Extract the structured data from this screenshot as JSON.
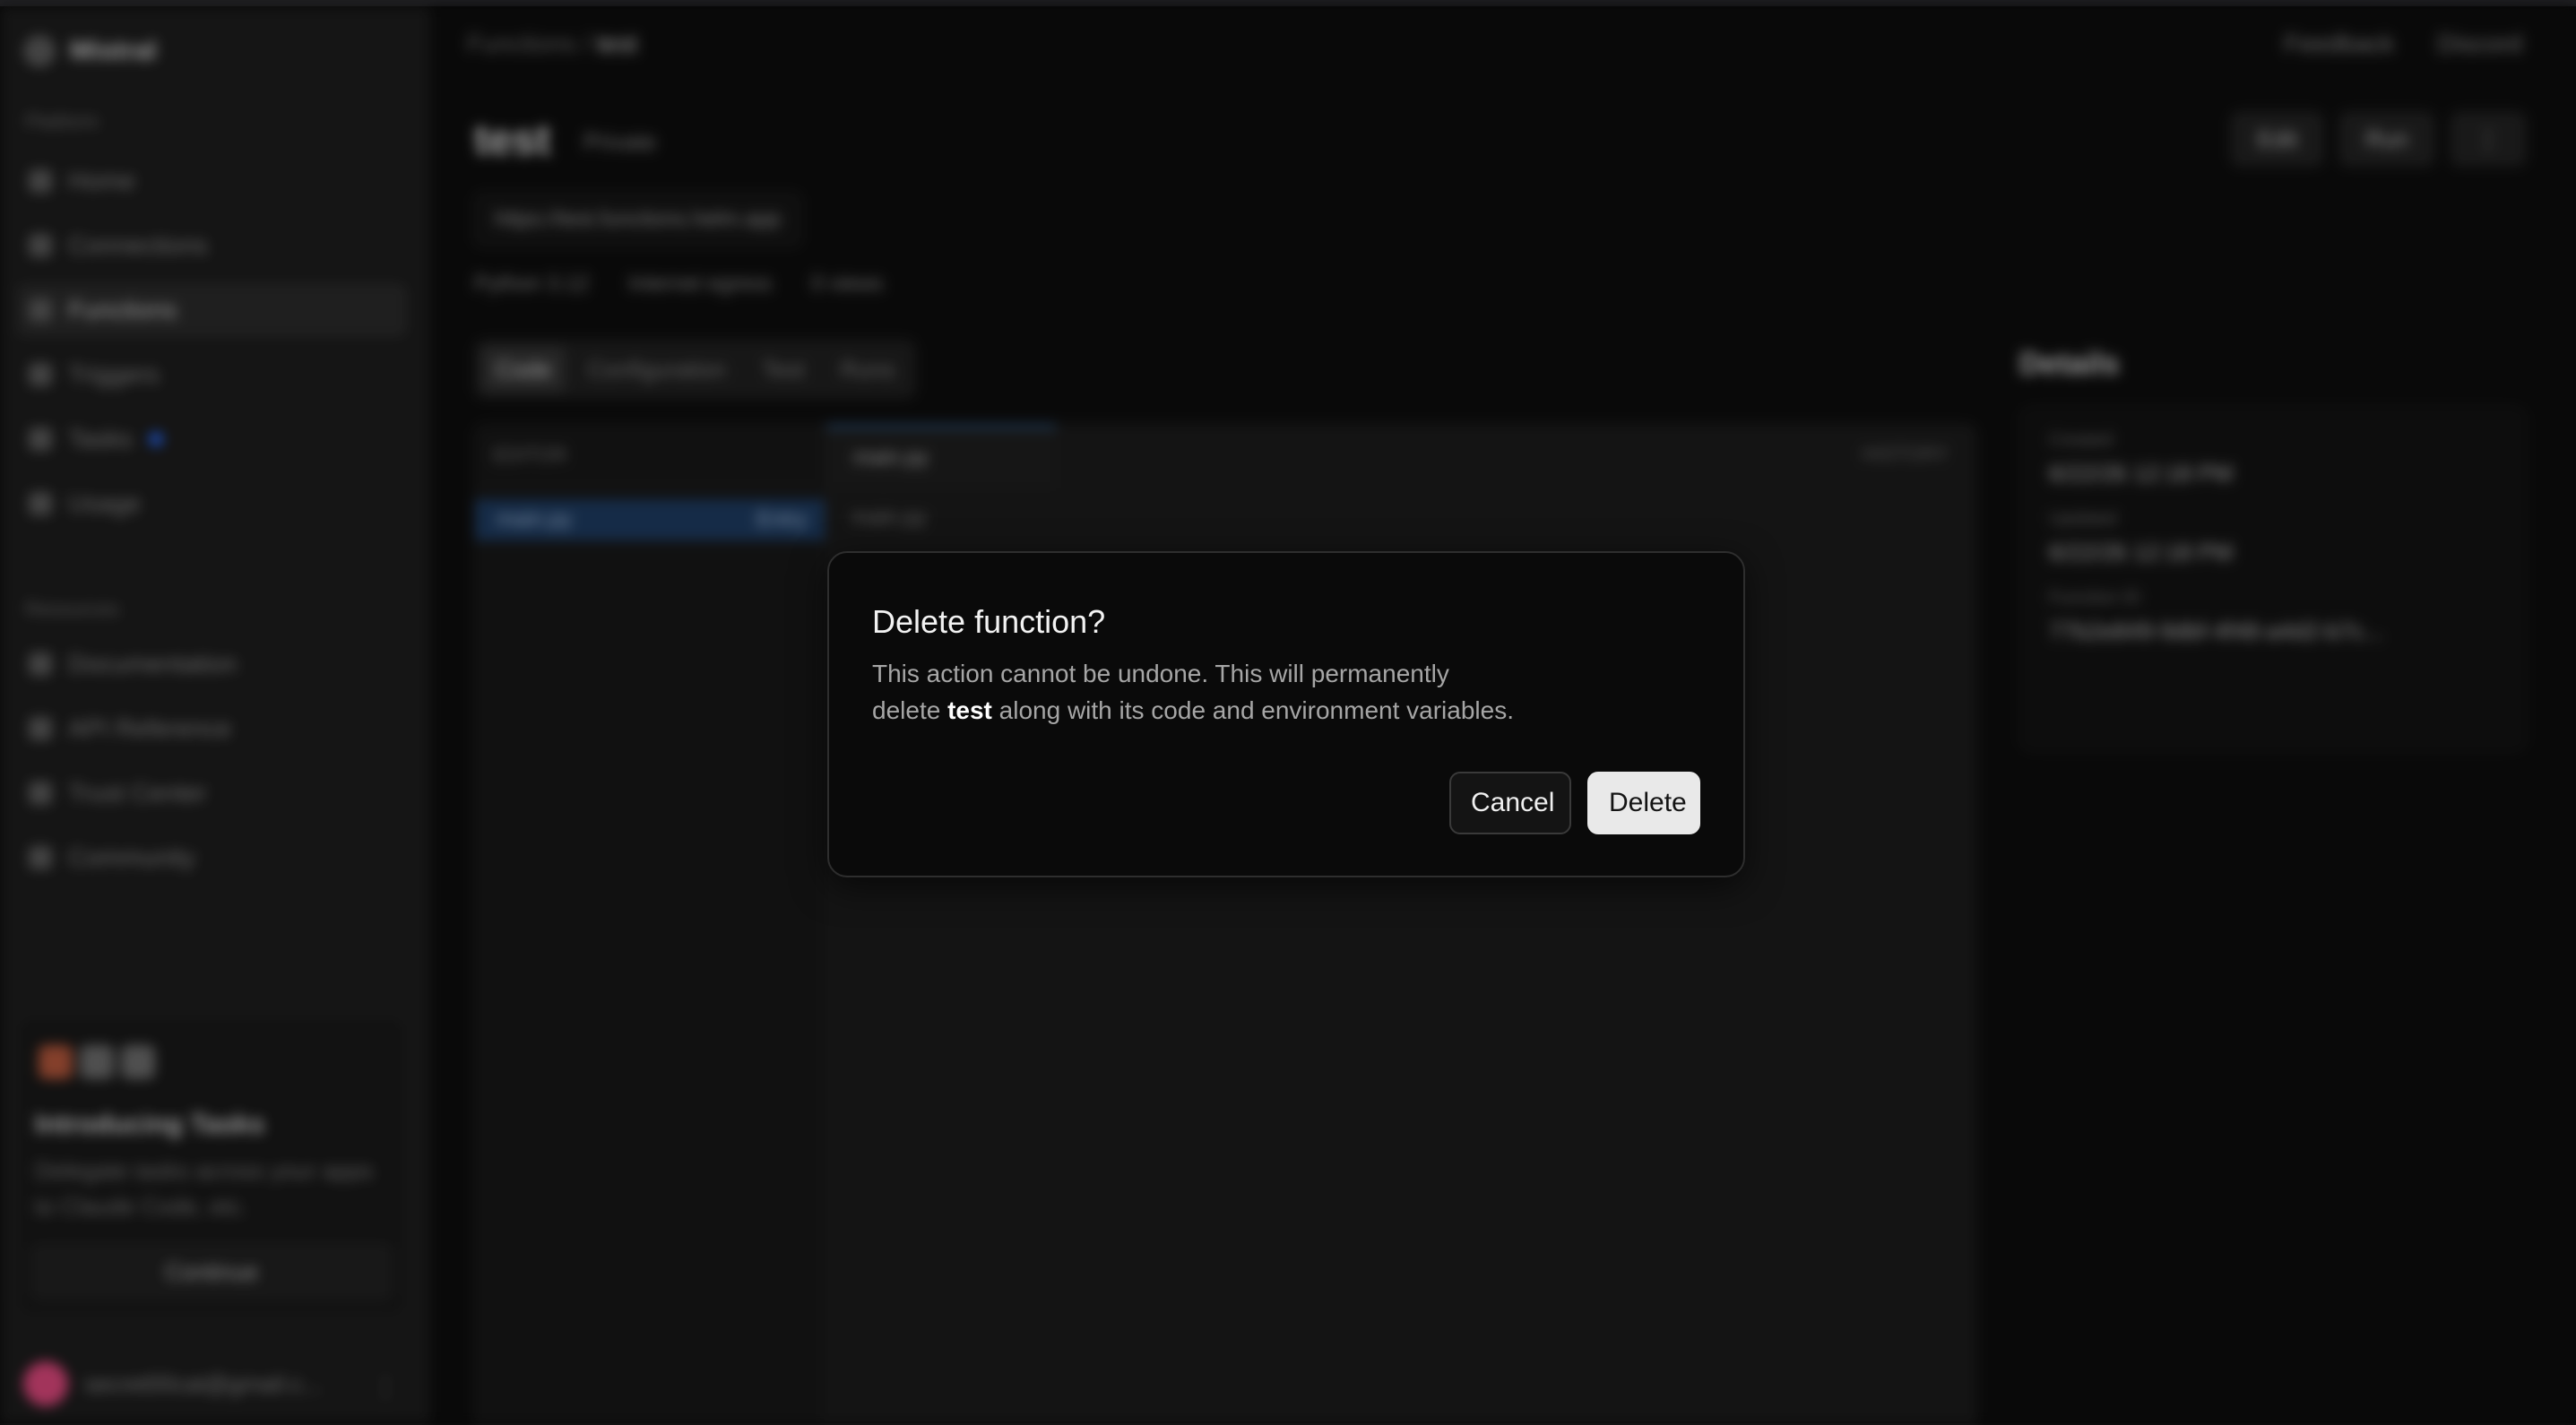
{
  "app": {
    "brand": "Mistral",
    "sidebar": {
      "platform_label": "Platform",
      "platform_items": [
        {
          "label": "Home",
          "icon": "home-icon"
        },
        {
          "label": "Connections",
          "icon": "plug-icon"
        },
        {
          "label": "Functions",
          "icon": "code-icon",
          "active": true
        },
        {
          "label": "Triggers",
          "icon": "bolt-icon"
        },
        {
          "label": "Tasks",
          "icon": "check-icon"
        },
        {
          "label": "Usage",
          "icon": "chart-icon"
        }
      ],
      "resources_label": "Resources",
      "resource_items": [
        {
          "label": "Documentation",
          "icon": "book-icon"
        },
        {
          "label": "API Reference",
          "icon": "code-icon"
        },
        {
          "label": "Trust Center",
          "icon": "shield-icon"
        },
        {
          "label": "Community",
          "icon": "people-icon"
        }
      ],
      "promo": {
        "title": "Introducing Tasks",
        "description": "Delegate tasks across your apps to Claude Code, etc.",
        "button": "Continue"
      },
      "user_email": "secret00cat@gmail.c...",
      "user_more": "⋮"
    },
    "breadcrumb": {
      "root": "Functions",
      "separator": "/",
      "current": "test"
    },
    "top_actions": [
      "Feedback",
      "Discord"
    ],
    "function": {
      "title": "test",
      "visibility": "Private",
      "url": "https://test.functions.helm.app",
      "chips": [
        "Python 3.12",
        "Internet egress",
        "0 views"
      ],
      "header_buttons": [
        "Edit",
        "Run",
        "⋮"
      ]
    },
    "tabs": [
      {
        "label": "Code",
        "active": true
      },
      {
        "label": "Configuration"
      },
      {
        "label": "Test"
      },
      {
        "label": "Runs"
      }
    ],
    "editor": {
      "explorer_label": "EDITOR",
      "file": "main.py",
      "file_badge": "Entry",
      "open_tab": "main.py",
      "path": "main.py",
      "history_label": "HISTORY"
    },
    "details": {
      "title": "Details",
      "rows": [
        {
          "key": "Created",
          "value": "6/22/26 12:18 PM"
        },
        {
          "key": "Updated",
          "value": "6/22/26 12:18 PM"
        },
        {
          "key": "Function ID",
          "value": "77b2e849-9dbf-4f48-a4d2-b7c..."
        }
      ]
    }
  },
  "dialog": {
    "title": "Delete function?",
    "body_line1": "This action cannot be undone. This will permanently",
    "body_prefix": "delete",
    "function_name": "test",
    "body_suffix": "along with its code and environment variables.",
    "cancel_label": "Cancel",
    "delete_label": "Delete"
  }
}
